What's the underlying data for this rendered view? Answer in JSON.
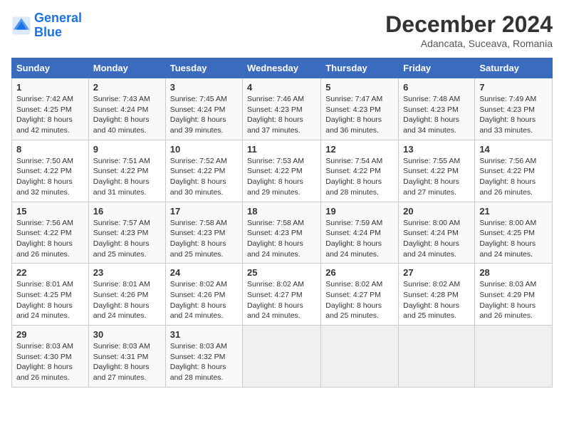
{
  "header": {
    "logo_line1": "General",
    "logo_line2": "Blue",
    "month": "December 2024",
    "location": "Adancata, Suceava, Romania"
  },
  "columns": [
    "Sunday",
    "Monday",
    "Tuesday",
    "Wednesday",
    "Thursday",
    "Friday",
    "Saturday"
  ],
  "weeks": [
    [
      {
        "day": "1",
        "sunrise": "Sunrise: 7:42 AM",
        "sunset": "Sunset: 4:25 PM",
        "daylight": "Daylight: 8 hours and 42 minutes."
      },
      {
        "day": "2",
        "sunrise": "Sunrise: 7:43 AM",
        "sunset": "Sunset: 4:24 PM",
        "daylight": "Daylight: 8 hours and 40 minutes."
      },
      {
        "day": "3",
        "sunrise": "Sunrise: 7:45 AM",
        "sunset": "Sunset: 4:24 PM",
        "daylight": "Daylight: 8 hours and 39 minutes."
      },
      {
        "day": "4",
        "sunrise": "Sunrise: 7:46 AM",
        "sunset": "Sunset: 4:23 PM",
        "daylight": "Daylight: 8 hours and 37 minutes."
      },
      {
        "day": "5",
        "sunrise": "Sunrise: 7:47 AM",
        "sunset": "Sunset: 4:23 PM",
        "daylight": "Daylight: 8 hours and 36 minutes."
      },
      {
        "day": "6",
        "sunrise": "Sunrise: 7:48 AM",
        "sunset": "Sunset: 4:23 PM",
        "daylight": "Daylight: 8 hours and 34 minutes."
      },
      {
        "day": "7",
        "sunrise": "Sunrise: 7:49 AM",
        "sunset": "Sunset: 4:23 PM",
        "daylight": "Daylight: 8 hours and 33 minutes."
      }
    ],
    [
      {
        "day": "8",
        "sunrise": "Sunrise: 7:50 AM",
        "sunset": "Sunset: 4:22 PM",
        "daylight": "Daylight: 8 hours and 32 minutes."
      },
      {
        "day": "9",
        "sunrise": "Sunrise: 7:51 AM",
        "sunset": "Sunset: 4:22 PM",
        "daylight": "Daylight: 8 hours and 31 minutes."
      },
      {
        "day": "10",
        "sunrise": "Sunrise: 7:52 AM",
        "sunset": "Sunset: 4:22 PM",
        "daylight": "Daylight: 8 hours and 30 minutes."
      },
      {
        "day": "11",
        "sunrise": "Sunrise: 7:53 AM",
        "sunset": "Sunset: 4:22 PM",
        "daylight": "Daylight: 8 hours and 29 minutes."
      },
      {
        "day": "12",
        "sunrise": "Sunrise: 7:54 AM",
        "sunset": "Sunset: 4:22 PM",
        "daylight": "Daylight: 8 hours and 28 minutes."
      },
      {
        "day": "13",
        "sunrise": "Sunrise: 7:55 AM",
        "sunset": "Sunset: 4:22 PM",
        "daylight": "Daylight: 8 hours and 27 minutes."
      },
      {
        "day": "14",
        "sunrise": "Sunrise: 7:56 AM",
        "sunset": "Sunset: 4:22 PM",
        "daylight": "Daylight: 8 hours and 26 minutes."
      }
    ],
    [
      {
        "day": "15",
        "sunrise": "Sunrise: 7:56 AM",
        "sunset": "Sunset: 4:22 PM",
        "daylight": "Daylight: 8 hours and 26 minutes."
      },
      {
        "day": "16",
        "sunrise": "Sunrise: 7:57 AM",
        "sunset": "Sunset: 4:23 PM",
        "daylight": "Daylight: 8 hours and 25 minutes."
      },
      {
        "day": "17",
        "sunrise": "Sunrise: 7:58 AM",
        "sunset": "Sunset: 4:23 PM",
        "daylight": "Daylight: 8 hours and 25 minutes."
      },
      {
        "day": "18",
        "sunrise": "Sunrise: 7:58 AM",
        "sunset": "Sunset: 4:23 PM",
        "daylight": "Daylight: 8 hours and 24 minutes."
      },
      {
        "day": "19",
        "sunrise": "Sunrise: 7:59 AM",
        "sunset": "Sunset: 4:24 PM",
        "daylight": "Daylight: 8 hours and 24 minutes."
      },
      {
        "day": "20",
        "sunrise": "Sunrise: 8:00 AM",
        "sunset": "Sunset: 4:24 PM",
        "daylight": "Daylight: 8 hours and 24 minutes."
      },
      {
        "day": "21",
        "sunrise": "Sunrise: 8:00 AM",
        "sunset": "Sunset: 4:25 PM",
        "daylight": "Daylight: 8 hours and 24 minutes."
      }
    ],
    [
      {
        "day": "22",
        "sunrise": "Sunrise: 8:01 AM",
        "sunset": "Sunset: 4:25 PM",
        "daylight": "Daylight: 8 hours and 24 minutes."
      },
      {
        "day": "23",
        "sunrise": "Sunrise: 8:01 AM",
        "sunset": "Sunset: 4:26 PM",
        "daylight": "Daylight: 8 hours and 24 minutes."
      },
      {
        "day": "24",
        "sunrise": "Sunrise: 8:02 AM",
        "sunset": "Sunset: 4:26 PM",
        "daylight": "Daylight: 8 hours and 24 minutes."
      },
      {
        "day": "25",
        "sunrise": "Sunrise: 8:02 AM",
        "sunset": "Sunset: 4:27 PM",
        "daylight": "Daylight: 8 hours and 24 minutes."
      },
      {
        "day": "26",
        "sunrise": "Sunrise: 8:02 AM",
        "sunset": "Sunset: 4:27 PM",
        "daylight": "Daylight: 8 hours and 25 minutes."
      },
      {
        "day": "27",
        "sunrise": "Sunrise: 8:02 AM",
        "sunset": "Sunset: 4:28 PM",
        "daylight": "Daylight: 8 hours and 25 minutes."
      },
      {
        "day": "28",
        "sunrise": "Sunrise: 8:03 AM",
        "sunset": "Sunset: 4:29 PM",
        "daylight": "Daylight: 8 hours and 26 minutes."
      }
    ],
    [
      {
        "day": "29",
        "sunrise": "Sunrise: 8:03 AM",
        "sunset": "Sunset: 4:30 PM",
        "daylight": "Daylight: 8 hours and 26 minutes."
      },
      {
        "day": "30",
        "sunrise": "Sunrise: 8:03 AM",
        "sunset": "Sunset: 4:31 PM",
        "daylight": "Daylight: 8 hours and 27 minutes."
      },
      {
        "day": "31",
        "sunrise": "Sunrise: 8:03 AM",
        "sunset": "Sunset: 4:32 PM",
        "daylight": "Daylight: 8 hours and 28 minutes."
      },
      null,
      null,
      null,
      null
    ]
  ]
}
